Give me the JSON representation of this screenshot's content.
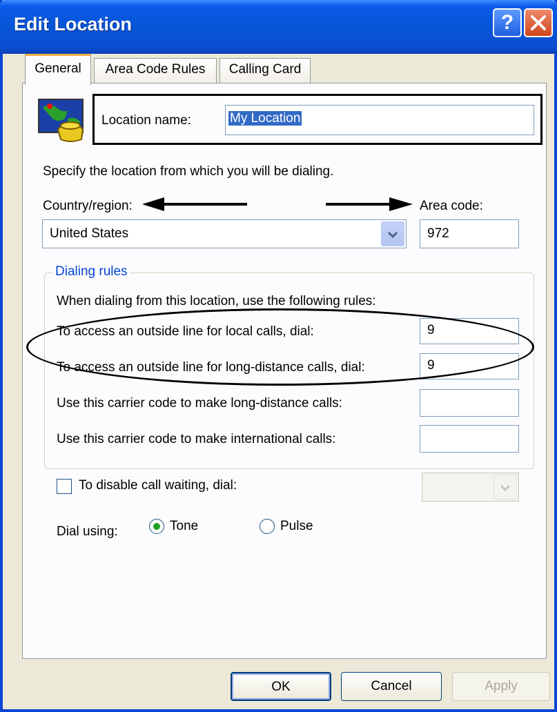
{
  "window": {
    "title": "Edit Location"
  },
  "tabs": [
    {
      "label": "General",
      "active": true
    },
    {
      "label": "Area Code Rules",
      "active": false
    },
    {
      "label": "Calling Card",
      "active": false
    }
  ],
  "icons": {
    "location": "location-globe-phone-icon",
    "help": "help-icon",
    "close": "close-icon",
    "dropdown": "chevron-down-icon"
  },
  "location": {
    "label": "Location name:",
    "value": "My Location"
  },
  "specify_text": "Specify the location from which you will be dialing.",
  "country": {
    "label": "Country/region:",
    "value": "United States"
  },
  "area_code": {
    "label": "Area code:",
    "value": "972"
  },
  "dialing_rules": {
    "legend": "Dialing rules",
    "intro": "When dialing from this location, use the following rules:",
    "rows": [
      {
        "label": "To access an outside line for local calls, dial:",
        "value": "9"
      },
      {
        "label": "To access an outside line for long-distance calls, dial:",
        "value": "9"
      },
      {
        "label": "Use this carrier code to make long-distance calls:",
        "value": ""
      },
      {
        "label": "Use this carrier code to make international calls:",
        "value": ""
      }
    ]
  },
  "call_waiting": {
    "label": "To disable call waiting, dial:",
    "checked": false,
    "value": ""
  },
  "dial_using": {
    "label": "Dial using:",
    "options": [
      {
        "label": "Tone",
        "selected": true
      },
      {
        "label": "Pulse",
        "selected": false
      }
    ]
  },
  "buttons": {
    "ok": "OK",
    "cancel": "Cancel",
    "apply": "Apply"
  },
  "colors": {
    "titlebar": "#0754d6",
    "dialog_bg": "#ece9d8",
    "group_label": "#0046d5",
    "selection": "#316ac5"
  }
}
